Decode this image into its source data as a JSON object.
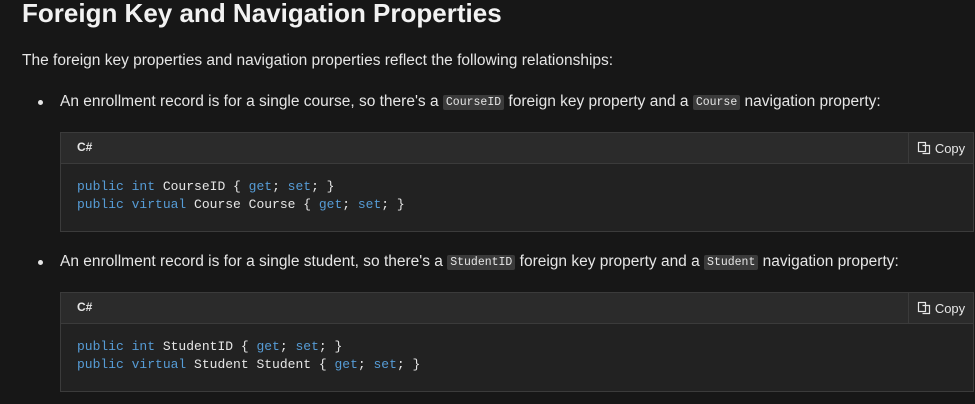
{
  "heading": "Foreign Key and Navigation Properties",
  "intro": "The foreign key properties and navigation properties reflect the following relationships:",
  "bullets": [
    {
      "text_before": "An enrollment record is for a single course, so there's a ",
      "code_1": "CourseID",
      "text_middle": " foreign key property and a ",
      "code_2": "Course",
      "text_after": " navigation property:",
      "code_block": {
        "language": "C#",
        "copy_label": "Copy",
        "line_1": {
          "kw_1": "public",
          "kw_2": "int",
          "name": " CourseID { ",
          "get": "get",
          "sep": "; ",
          "set": "set",
          "end": "; }"
        },
        "line_2": {
          "kw_1": "public",
          "kw_2": "virtual",
          "name": " Course Course { ",
          "get": "get",
          "sep": "; ",
          "set": "set",
          "end": "; }"
        }
      }
    },
    {
      "text_before": "An enrollment record is for a single student, so there's a ",
      "code_1": "StudentID",
      "text_middle": " foreign key property and a ",
      "code_2": "Student",
      "text_after": " navigation property:",
      "code_block": {
        "language": "C#",
        "copy_label": "Copy",
        "line_1": {
          "kw_1": "public",
          "kw_2": "int",
          "name": " StudentID { ",
          "get": "get",
          "sep": "; ",
          "set": "set",
          "end": "; }"
        },
        "line_2": {
          "kw_1": "public",
          "kw_2": "virtual",
          "name": " Student Student { ",
          "get": "get",
          "sep": "; ",
          "set": "set",
          "end": "; }"
        }
      }
    }
  ],
  "icons": {
    "copy": "copy-icon"
  },
  "colors": {
    "keyword": "#569cd6",
    "background": "#171717",
    "code_background": "#222222"
  }
}
